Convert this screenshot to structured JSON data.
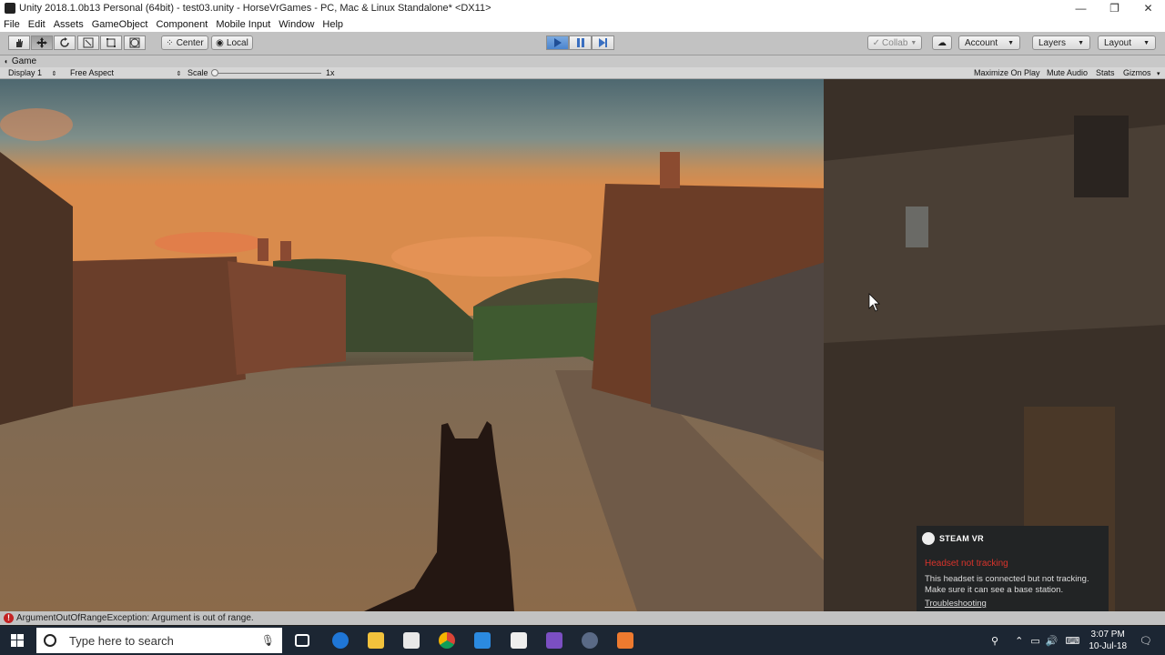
{
  "window": {
    "title": "Unity 2018.1.0b13 Personal (64bit) - test03.unity - HorseVrGames - PC, Mac & Linux Standalone* <DX11>",
    "minimize": "—",
    "maximize": "❐",
    "close": "✕"
  },
  "menu": [
    "File",
    "Edit",
    "Assets",
    "GameObject",
    "Component",
    "Mobile Input",
    "Window",
    "Help"
  ],
  "toolbar": {
    "tools": [
      "hand-tool",
      "move-tool",
      "rotate-tool",
      "scale-tool",
      "rect-tool",
      "transform-tool"
    ],
    "pivot": "Center",
    "space": "Local",
    "collab": "Collab",
    "account": "Account",
    "layers": "Layers",
    "layout": "Layout"
  },
  "game_view": {
    "tab": "Game",
    "display": "Display 1",
    "aspect": "Free Aspect",
    "scale_label": "Scale",
    "scale_value": "1x",
    "maximize": "Maximize On Play",
    "mute": "Mute Audio",
    "stats": "Stats",
    "gizmos": "Gizmos"
  },
  "status": {
    "error": "ArgumentOutOfRangeException: Argument is out of range."
  },
  "steamvr": {
    "brand": "STEAM VR",
    "title": "Headset not tracking",
    "message": "This headset is connected but not tracking. Make sure it can see a base station.",
    "link": "Troubleshooting"
  },
  "taskbar": {
    "search_placeholder": "Type here to search",
    "time": "3:07 PM",
    "date": "10-Jul-18"
  },
  "colors": {
    "play_active": "#4a84cf",
    "error": "#c32222",
    "steam_warning": "#d9342b",
    "taskbar": "#1c2633"
  }
}
